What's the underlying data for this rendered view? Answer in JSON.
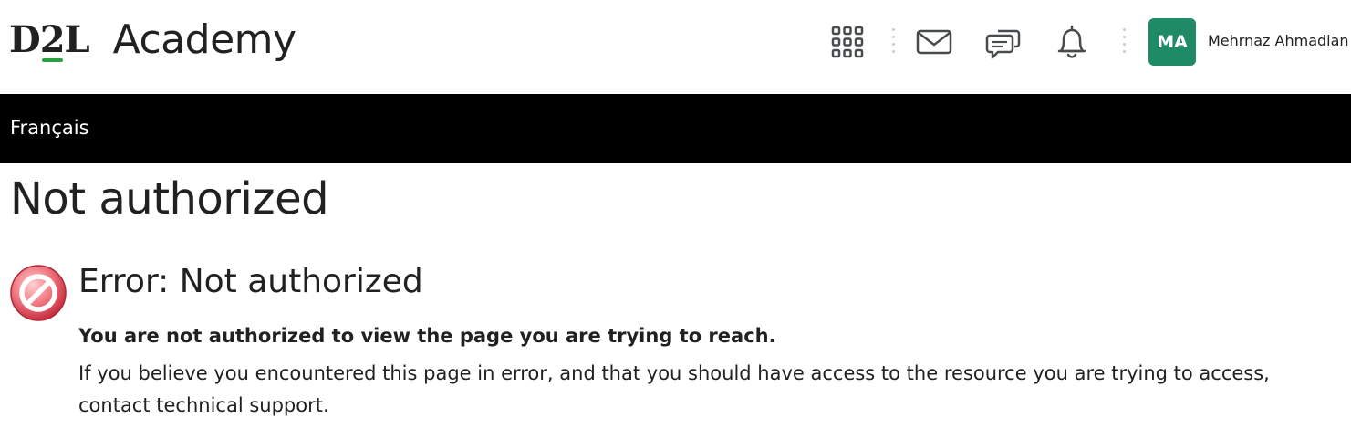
{
  "header": {
    "logo_brand": "D2L",
    "logo_product": "Academy",
    "icons": [
      {
        "name": "waffle-icon"
      },
      {
        "name": "email-icon"
      },
      {
        "name": "chat-icon"
      },
      {
        "name": "bell-icon"
      }
    ],
    "user": {
      "initials": "MA",
      "name": "Mehrnaz Ahmadian",
      "avatar_color": "#1f8a66"
    }
  },
  "navbar": {
    "link_label": "Français"
  },
  "page": {
    "title": "Not authorized",
    "error_heading": "Error: Not authorized",
    "error_message_bold": "You are not authorized to view the page you are trying to reach.",
    "error_message": "If you believe you encountered this page in error, and that you should have access to the resource you are trying to access, contact technical support."
  },
  "colors": {
    "brand_green": "#2ca041",
    "navbar": "#000000",
    "error_icon": "#e05560"
  }
}
